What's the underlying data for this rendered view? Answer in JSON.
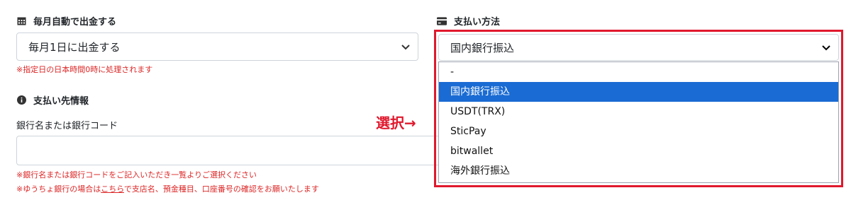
{
  "withdraw": {
    "label": "毎月自動で出金する",
    "icon": "calendar-icon",
    "selected": "毎月1日に出金する",
    "note": "※指定日の日本時間0時に処理されます"
  },
  "payment_method": {
    "label": "支払い方法",
    "icon": "credit-card-icon",
    "selected": "国内銀行振込",
    "options": [
      "-",
      "国内銀行振込",
      "USDT(TRX)",
      "SticPay",
      "bitwallet",
      "海外銀行振込"
    ],
    "highlight_color": "#e0182d",
    "selected_color": "#1a6bd3"
  },
  "payee": {
    "label": "支払い先情報",
    "icon": "info-circle-icon",
    "bank_label": "銀行名または銀行コード",
    "bank_value": "",
    "note1": "※銀行名または銀行コードをご記入いただき一覧よりご選択ください",
    "note2_prefix": "※ゆうちょ銀行の場合は",
    "note2_link": "こちら",
    "note2_suffix": "で支店名、預金種目、口座番号の確認をお願いたします"
  },
  "annotation": {
    "text": "選択→"
  }
}
